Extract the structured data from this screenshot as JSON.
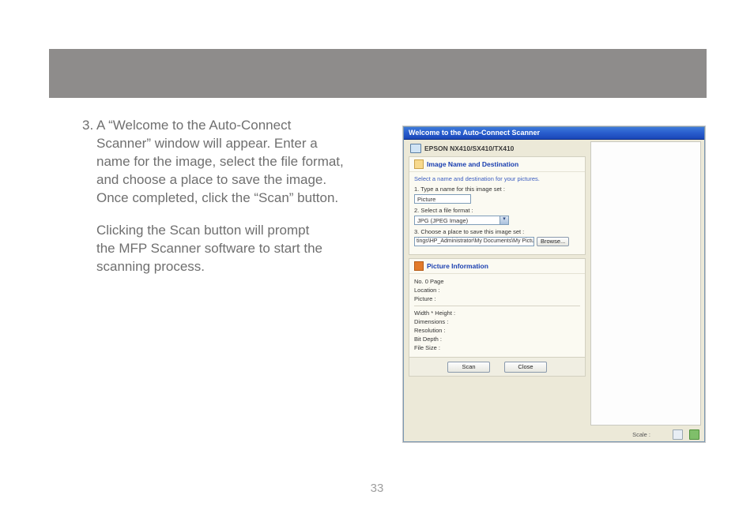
{
  "page": {
    "number": "33"
  },
  "instruction": {
    "item_number": "3.",
    "para1_line1": "A “Welcome to the Auto-Connect",
    "para1_line2": "Scanner” window will appear. Enter a",
    "para1_line3": "name for the image, select the file format,",
    "para1_line4": "and choose a place to save the image.",
    "para1_line5": "Once completed, click the “Scan” button.",
    "para2_line1": "Clicking the Scan button will prompt",
    "para2_line2": "the MFP Scanner software to start the",
    "para2_line3": "scanning process."
  },
  "scanner_window": {
    "title": "Welcome to the Auto-Connect Scanner",
    "device": "EPSON NX410/SX410/TX410",
    "section1": {
      "header": "Image Name and Destination",
      "hint": "Select a name and destination for your pictures.",
      "field1_label": "1. Type a name for this image set :",
      "field1_value": "Picture",
      "field2_label": "2. Select a file format :",
      "field2_value": "JPG (JPEG Image)",
      "field3_label": "3. Choose a place to save this image set :",
      "field3_value": "tings\\HP_Administrator\\My Documents\\My Pictures\\",
      "browse": "Browse..."
    },
    "section2": {
      "header": "Picture Information",
      "rows": {
        "no_page": "No. 0 Page",
        "location": "Location :",
        "picture": "Picture :",
        "wh": "Width * Height :",
        "dimensions": "Dimensions :",
        "resolution": "Resolution :",
        "bitdepth": "Bit Depth :",
        "filesize": "File Size :"
      }
    },
    "buttons": {
      "scan": "Scan",
      "close": "Close"
    },
    "statusbar": {
      "scale": "Scale :"
    }
  }
}
